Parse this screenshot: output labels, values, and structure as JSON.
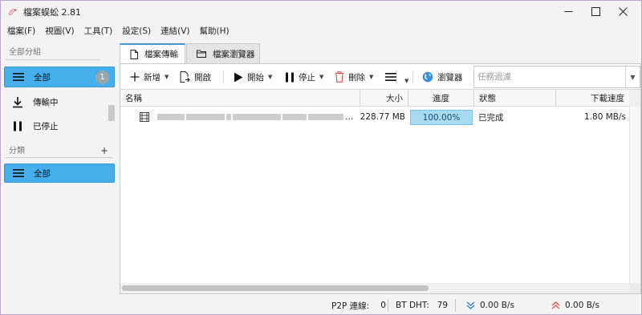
{
  "window": {
    "title": "檔案蜈蚣 2.81",
    "controls": {
      "minimize": "—",
      "maximize": "☐",
      "close": "✕"
    }
  },
  "menu": [
    "檔案(F)",
    "視圖(V)",
    "工具(T)",
    "設定(S)",
    "連結(V)",
    "幫助(H)"
  ],
  "sidebar": {
    "all_groups_label": "全部分組",
    "items": [
      {
        "label": "全部",
        "icon": "list-icon",
        "count": "1",
        "active": true
      },
      {
        "label": "傳輸中",
        "icon": "download-icon",
        "active": false
      },
      {
        "label": "已停止",
        "icon": "pause-icon",
        "active": false
      }
    ],
    "categories_label": "分類",
    "add_category": "+",
    "category_items": [
      {
        "label": "全部",
        "icon": "list-icon",
        "active": true
      }
    ]
  },
  "tabs": [
    {
      "label": "檔案傳輸",
      "icon": "document-icon",
      "active": true
    },
    {
      "label": "檔案瀏覽器",
      "icon": "folder-icon",
      "active": false
    }
  ],
  "toolbar": {
    "new": "新增",
    "open": "開啟",
    "start": "開始",
    "stop": "停止",
    "delete": "刪除",
    "browser": "瀏覽器",
    "filter_placeholder": "任務過濾"
  },
  "table": {
    "columns": [
      "名稱",
      "大小",
      "進度",
      "狀態",
      "下載速度"
    ],
    "rows": [
      {
        "name": "…",
        "size": "228.77 MB",
        "progress": "100.00%",
        "progress_value": 1.0,
        "status": "已完成",
        "speed": "1.80 MB/s"
      }
    ]
  },
  "status": {
    "p2p_label": "P2P 連線:",
    "p2p_value": "0",
    "dht_label": "BT DHT:",
    "dht_value": "79",
    "download_speed": "0.00 B/s",
    "upload_speed": "0.00 B/s"
  },
  "colors": {
    "accent": "#46aeeb",
    "progress_fill": "#a8daf3",
    "download_arrow": "#2f7fd6",
    "upload_arrow": "#e0534b",
    "delete_red": "#d9534f"
  }
}
